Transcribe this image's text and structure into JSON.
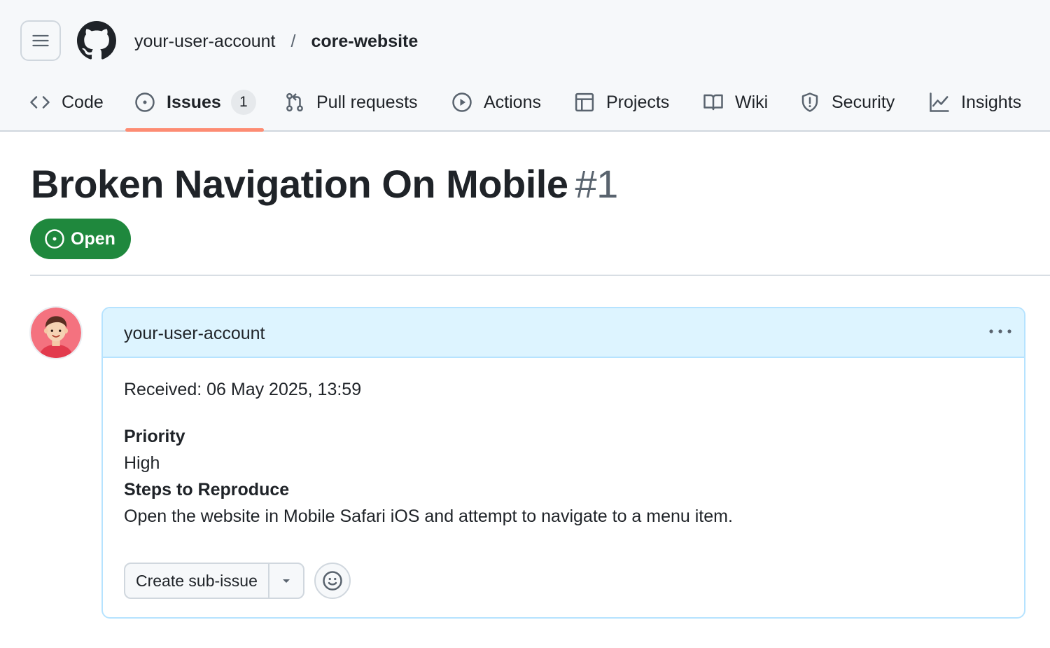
{
  "repo": {
    "owner": "your-user-account",
    "separator": "/",
    "name": "core-website"
  },
  "tabs": [
    {
      "label": "Code",
      "icon": "code-icon"
    },
    {
      "label": "Issues",
      "icon": "issue-opened-icon",
      "counter": "1",
      "selected": true
    },
    {
      "label": "Pull requests",
      "icon": "git-pull-request-icon"
    },
    {
      "label": "Actions",
      "icon": "play-icon"
    },
    {
      "label": "Projects",
      "icon": "table-icon"
    },
    {
      "label": "Wiki",
      "icon": "book-icon"
    },
    {
      "label": "Security",
      "icon": "shield-icon"
    },
    {
      "label": "Insights",
      "icon": "graph-icon"
    }
  ],
  "issue": {
    "title": "Broken Navigation On Mobile",
    "number": "#1",
    "state": "Open"
  },
  "comment": {
    "author": "your-user-account",
    "received": "Received: 06 May 2025, 13:59",
    "priority_heading": "Priority",
    "priority_value": "High",
    "steps_heading": "Steps to Reproduce",
    "steps_value": "Open the website in Mobile Safari iOS and attempt to navigate to a menu item.",
    "create_sub_issue_label": "Create sub-issue"
  },
  "colors": {
    "open_state": "#1f883d",
    "selected_tab_underline": "#fd8c73",
    "comment_header_bg": "#ddf4ff",
    "comment_border": "#b6e3ff"
  }
}
